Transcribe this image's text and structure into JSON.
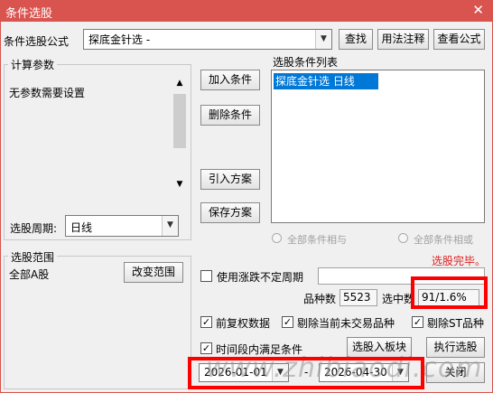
{
  "window": {
    "title": "条件选股",
    "close_glyph": "✕"
  },
  "formula": {
    "label": "条件选股公式",
    "selected": "探底金针选  -",
    "find_button": "查找",
    "usage_button": "用法注释",
    "view_button": "查看公式"
  },
  "params": {
    "group_title": "计算参数",
    "empty_text": "无参数需要设置",
    "period_label": "选股周期:",
    "period_value": "日线"
  },
  "actions": {
    "add": "加入条件",
    "delete": "删除条件",
    "import": "引入方案",
    "save": "保存方案"
  },
  "conditions": {
    "title": "选股条件列表",
    "items": [
      "探底金针选  日线"
    ],
    "radio_and": "全部条件相与",
    "radio_or": "全部条件相或",
    "status": "选股完毕。"
  },
  "scope": {
    "group_title": "选股范围",
    "value": "全部A股",
    "change_button": "改变范围"
  },
  "options": {
    "uncertain_period_label": "使用涨跌不定周期",
    "uncertain_period_value": "",
    "count_label": "品种数",
    "count_value": "5523",
    "selected_label": "选中数",
    "selected_value": "91/1.6%",
    "adjusted_label": "前复权数据",
    "exclude_untraded_label": "剔除当前未交易品种",
    "exclude_st_label": "剔除ST品种",
    "period_satisfy_label": "时间段内满足条件",
    "to_block_button": "选股入板块",
    "execute_button": "执行选股",
    "close_button": "关闭",
    "start_date": "2026-01-01",
    "date_sep": "-",
    "end_date": "2026-04-30",
    "check_glyph": "✓"
  },
  "watermark": "www.zhibiaodi.com",
  "colors": {
    "titlebar": "#d9534f",
    "selection": "#0078d7",
    "status": "#e02020",
    "highlight": "#ff0000"
  }
}
